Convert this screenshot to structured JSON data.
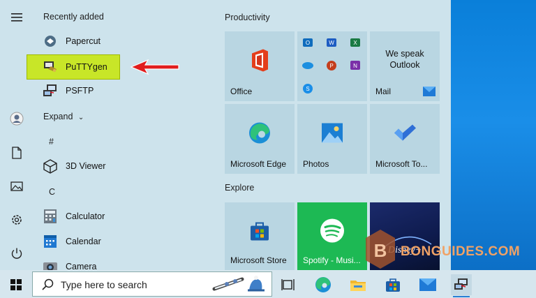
{
  "start_menu": {
    "recently_added_label": "Recently added",
    "recent_apps": [
      {
        "label": "Papercut",
        "icon": "papercut-icon"
      },
      {
        "label": "PuTTYgen",
        "icon": "puttygen-icon",
        "highlighted": true
      },
      {
        "label": "PSFTP",
        "icon": "psftp-icon"
      }
    ],
    "expand_label": "Expand",
    "letter_hash": "#",
    "letter_c": "C",
    "apps": [
      {
        "label": "3D Viewer",
        "icon": "cube-icon"
      },
      {
        "label": "Calculator",
        "icon": "calculator-icon"
      },
      {
        "label": "Calendar",
        "icon": "calendar-icon"
      },
      {
        "label": "Camera",
        "icon": "camera-icon"
      }
    ],
    "productivity_label": "Productivity",
    "explore_label": "Explore",
    "tiles": {
      "office": "Office",
      "mail_text": "We speak Outlook",
      "mail": "Mail",
      "edge": "Microsoft Edge",
      "photos": "Photos",
      "todo": "Microsoft To...",
      "store": "Microsoft Store",
      "spotify": "Spotify - Musi...",
      "disney": "Disney+"
    },
    "colors": {
      "highlight": "#c8e628",
      "accent_arrow": "#e11d1d",
      "spotify_green": "#1db954",
      "disney_navy": "#0e1b4d"
    }
  },
  "taskbar": {
    "search_placeholder": "Type here to search"
  },
  "watermark": {
    "text": "BONGUIDES.COM",
    "letter": "B"
  }
}
